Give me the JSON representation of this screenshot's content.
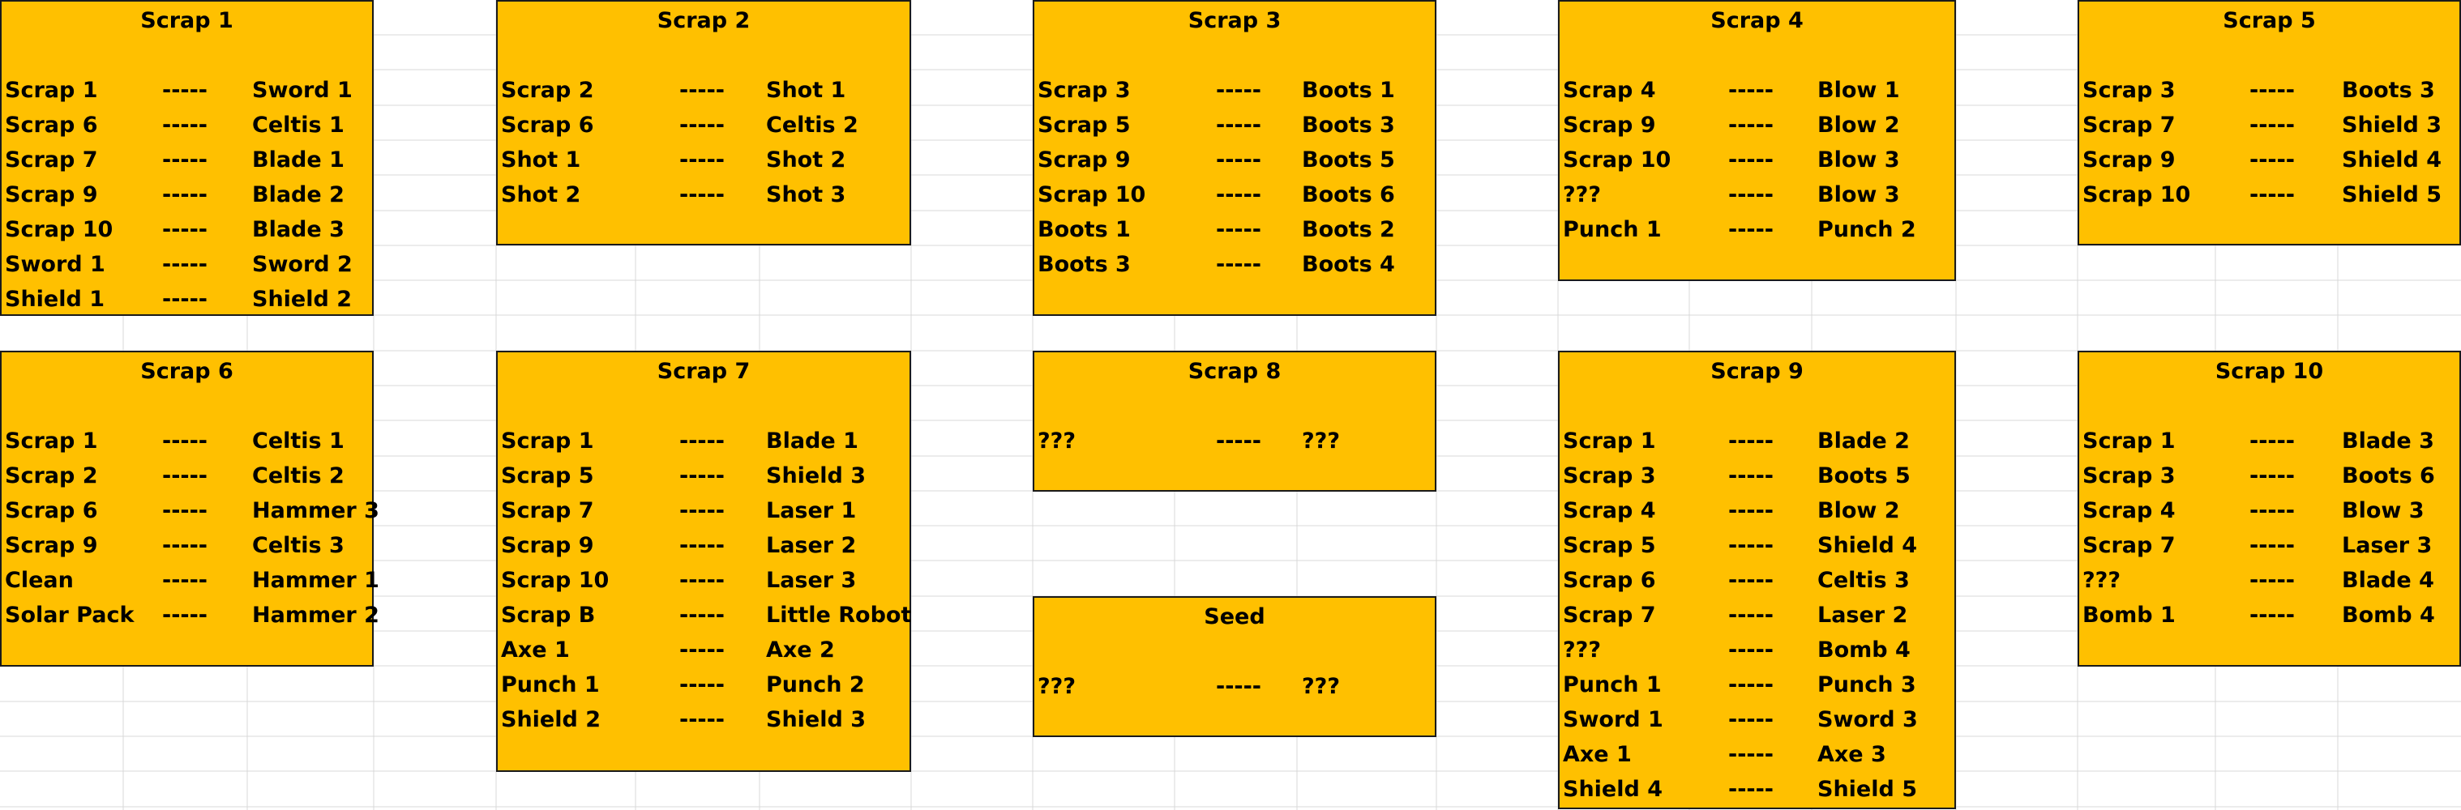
{
  "boxes": [
    {
      "title": "Scrap 1",
      "rows": [
        [
          "Scrap 1",
          "-----",
          "Sword 1"
        ],
        [
          "Scrap 6",
          "-----",
          "Celtis 1"
        ],
        [
          "Scrap 7",
          "-----",
          "Blade 1"
        ],
        [
          "Scrap 9",
          "-----",
          "Blade 2"
        ],
        [
          "Scrap 10",
          "-----",
          "Blade 3"
        ],
        [
          "Sword 1",
          "-----",
          "Sword 2"
        ],
        [
          "Shield 1",
          "-----",
          "Shield 2"
        ]
      ]
    },
    {
      "title": "Scrap 2",
      "rows": [
        [
          "Scrap 2",
          "-----",
          "Shot 1"
        ],
        [
          "Scrap 6",
          "-----",
          "Celtis 2"
        ],
        [
          "Shot 1",
          "-----",
          "Shot 2"
        ],
        [
          "Shot 2",
          "-----",
          "Shot 3"
        ]
      ]
    },
    {
      "title": "Scrap 3",
      "rows": [
        [
          "Scrap 3",
          "-----",
          "Boots 1"
        ],
        [
          "Scrap 5",
          "-----",
          "Boots 3"
        ],
        [
          "Scrap 9",
          "-----",
          "Boots 5"
        ],
        [
          "Scrap 10",
          "-----",
          "Boots 6"
        ],
        [
          "Boots 1",
          "-----",
          "Boots 2"
        ],
        [
          "Boots 3",
          "-----",
          "Boots 4"
        ]
      ]
    },
    {
      "title": "Scrap 4",
      "rows": [
        [
          "Scrap 4",
          "-----",
          "Blow 1"
        ],
        [
          "Scrap 9",
          "-----",
          "Blow 2"
        ],
        [
          "Scrap 10",
          "-----",
          "Blow 3"
        ],
        [
          "???",
          "-----",
          "Blow 3"
        ],
        [
          "Punch 1",
          "-----",
          "Punch 2"
        ]
      ]
    },
    {
      "title": "Scrap 5",
      "rows": [
        [
          "Scrap 3",
          "-----",
          "Boots 3"
        ],
        [
          "Scrap 7",
          "-----",
          "Shield 3"
        ],
        [
          "Scrap 9",
          "-----",
          "Shield 4"
        ],
        [
          "Scrap 10",
          "-----",
          "Shield 5"
        ]
      ]
    },
    {
      "title": "Scrap 6",
      "rows": [
        [
          "Scrap 1",
          "-----",
          "Celtis 1"
        ],
        [
          "Scrap 2",
          "-----",
          "Celtis 2"
        ],
        [
          "Scrap 6",
          "-----",
          "Hammer 3"
        ],
        [
          "Scrap 9",
          "-----",
          "Celtis 3"
        ],
        [
          "Clean",
          "-----",
          "Hammer 1"
        ],
        [
          "Solar Pack",
          "-----",
          "Hammer 2"
        ]
      ]
    },
    {
      "title": "Scrap 7",
      "rows": [
        [
          "Scrap 1",
          "-----",
          "Blade 1"
        ],
        [
          "Scrap 5",
          "-----",
          "Shield 3"
        ],
        [
          "Scrap 7",
          "-----",
          "Laser 1"
        ],
        [
          "Scrap 9",
          "-----",
          "Laser 2"
        ],
        [
          "Scrap 10",
          "-----",
          "Laser 3"
        ],
        [
          "Scrap B",
          "-----",
          "Little Robot"
        ],
        [
          "Axe 1",
          "-----",
          "Axe 2"
        ],
        [
          "Punch 1",
          "-----",
          "Punch 2"
        ],
        [
          "Shield 2",
          "-----",
          "Shield 3"
        ]
      ]
    },
    {
      "title": "Scrap 8",
      "rows": [
        [
          "???",
          "-----",
          "???"
        ]
      ]
    },
    {
      "title": "Seed",
      "rows": [
        [
          "???",
          "-----",
          "???"
        ]
      ]
    },
    {
      "title": "Scrap 9",
      "rows": [
        [
          "Scrap 1",
          "-----",
          "Blade 2"
        ],
        [
          "Scrap 3",
          "-----",
          "Boots 5"
        ],
        [
          "Scrap 4",
          "-----",
          "Blow 2"
        ],
        [
          "Scrap 5",
          "-----",
          "Shield 4"
        ],
        [
          "Scrap 6",
          "-----",
          "Celtis 3"
        ],
        [
          "Scrap 7",
          "-----",
          "Laser 2"
        ],
        [
          "???",
          "-----",
          "Bomb 4"
        ],
        [
          "Punch 1",
          "-----",
          "Punch 3"
        ],
        [
          "Sword 1",
          "-----",
          "Sword 3"
        ],
        [
          "Axe 1",
          "-----",
          "Axe 3"
        ],
        [
          "Shield 4",
          "-----",
          "Shield 5"
        ]
      ]
    },
    {
      "title": "Scrap 10",
      "rows": [
        [
          "Scrap 1",
          "-----",
          "Blade 3"
        ],
        [
          "Scrap 3",
          "-----",
          "Boots 6"
        ],
        [
          "Scrap 4",
          "-----",
          "Blow 3"
        ],
        [
          "Scrap 7",
          "-----",
          "Laser 3"
        ],
        [
          "???",
          "-----",
          "Blade 4"
        ],
        [
          "Bomb 1",
          "-----",
          "Bomb 4"
        ]
      ]
    }
  ]
}
